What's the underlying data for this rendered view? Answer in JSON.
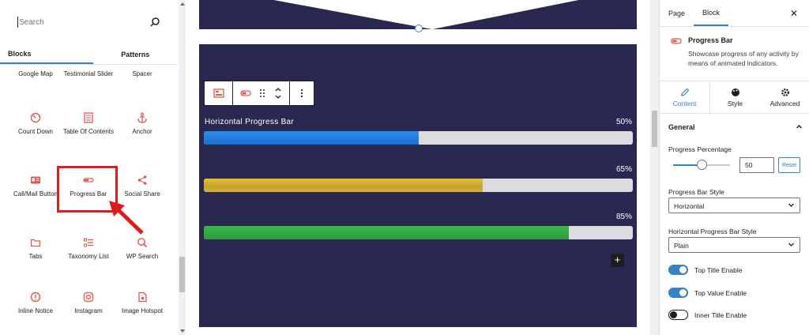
{
  "inserter": {
    "search_placeholder": "Search",
    "tabs": [
      "Blocks",
      "Patterns"
    ],
    "blocks": [
      {
        "label": "Google Map",
        "icon": "map-icon"
      },
      {
        "label": "Testimonial Slider",
        "icon": "slider-icon"
      },
      {
        "label": "Spacer",
        "icon": "spacer-icon"
      },
      {
        "label": "Count Down",
        "icon": "countdown-icon"
      },
      {
        "label": "Table Of Contents",
        "icon": "toc-icon"
      },
      {
        "label": "Anchor",
        "icon": "anchor-icon"
      },
      {
        "label": "Call/Mail Button",
        "icon": "contact-card-icon"
      },
      {
        "label": "Progress Bar",
        "icon": "progress-bar-icon"
      },
      {
        "label": "Social Share",
        "icon": "share-icon"
      },
      {
        "label": "Tabs",
        "icon": "folder-icon"
      },
      {
        "label": "Taxonomy List",
        "icon": "list-icon"
      },
      {
        "label": "WP Search",
        "icon": "search-zoom-icon"
      },
      {
        "label": "Inline Notice",
        "icon": "alert-icon"
      },
      {
        "label": "Instagram",
        "icon": "instagram-icon"
      },
      {
        "label": "Image Hotspot",
        "icon": "hotspot-icon"
      }
    ]
  },
  "canvas": {
    "bars": [
      {
        "title": "Horizontal Progress Bar",
        "value_label": "50%",
        "percent": 50,
        "fill": "linear-gradient(#2b8fe8,#1a6fd1)"
      },
      {
        "title": "",
        "value_label": "65%",
        "percent": 65,
        "fill": "linear-gradient(#e0c03a,#c9a229 60%,#d4b236)"
      },
      {
        "title": "",
        "value_label": "85%",
        "percent": 85,
        "fill": "linear-gradient(#3cb54a,#2a9d38)"
      }
    ],
    "add_symbol": "+"
  },
  "settings": {
    "tabs": [
      "Page",
      "Block"
    ],
    "close_symbol": "✕",
    "block_name": "Progress Bar",
    "block_desc": "Showcase progress of any activity by means of animated indicators.",
    "panel_tabs": [
      {
        "label": "Content",
        "icon": "pencil-icon"
      },
      {
        "label": "Style",
        "icon": "palette-icon"
      },
      {
        "label": "Advanced",
        "icon": "gear-icon"
      }
    ],
    "section": "General",
    "progress_label": "Progress Percentage",
    "progress_value": "50",
    "progress_fraction": 0.5,
    "reset_label": "Reset",
    "style_label": "Progress Bar Style",
    "style_value": "Horizontal",
    "hstyle_label": "Horizontal Progress Bar Style",
    "hstyle_value": "Plain",
    "toggles": [
      {
        "label": "Top Title Enable",
        "on": true
      },
      {
        "label": "Top Value Enable",
        "on": true
      },
      {
        "label": "Inner Title Enable",
        "on": false
      }
    ]
  },
  "colors": {
    "canvas_bg": "#292850",
    "accent": "#3582c4",
    "icon_red": "#e2574c",
    "highlight": "#e01b1b"
  }
}
